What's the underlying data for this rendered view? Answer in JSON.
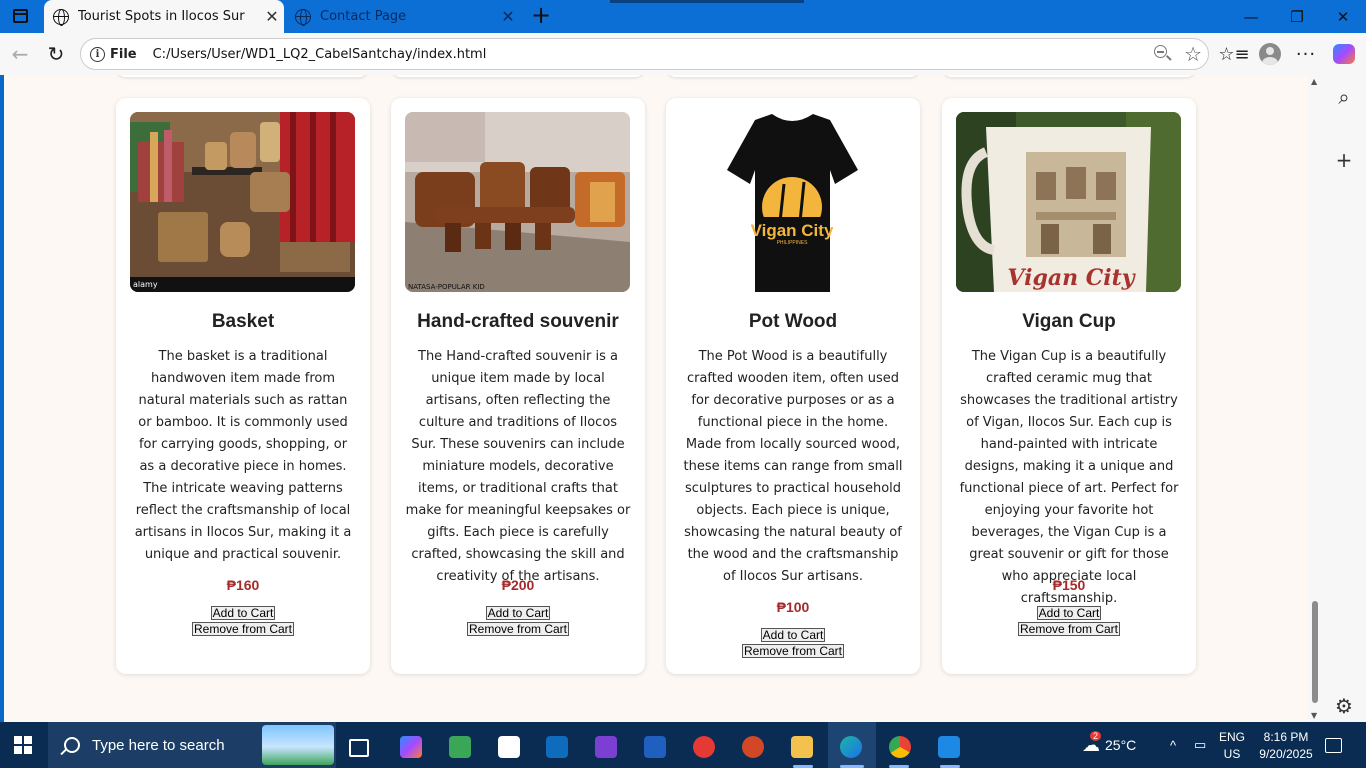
{
  "browser": {
    "tabs": [
      {
        "title": "Tourist Spots in Ilocos Sur",
        "active": true
      },
      {
        "title": "Contact Page",
        "active": false
      }
    ],
    "newtab_symbol": "+",
    "window_controls": {
      "minimize": "—",
      "restore": "❐",
      "close": "✕"
    },
    "address": {
      "protocol_label": "File",
      "url": "C:/Users/User/WD1_LQ2_CabelSantchay/index.html"
    },
    "nav": {
      "back": "←",
      "refresh": "↻"
    },
    "icons": {
      "star": "☆",
      "favorites": "☆≡",
      "more": "···"
    }
  },
  "page": {
    "products": [
      {
        "name": "Basket",
        "description": "The basket is a traditional handwoven item made from natural materials such as rattan or bamboo. It is commonly used for carrying goods, shopping, or as a decorative piece in homes. The intricate weaving patterns reflect the craftsmanship of local artisans in Ilocos Sur, making it a unique and practical souvenir.",
        "price": "₱160",
        "add_label": "Add to Cart",
        "remove_label": "Remove from Cart",
        "watermark": "alamy"
      },
      {
        "name": "Hand-crafted souvenir",
        "description": "The Hand-crafted souvenir is a unique item made by local artisans, often reflecting the culture and traditions of Ilocos Sur. These souvenirs can include miniature models, decorative items, or traditional crafts that make for meaningful keepsakes or gifts. Each piece is carefully crafted, showcasing the skill and creativity of the artisans.",
        "price": "₱200",
        "add_label": "Add to Cart",
        "remove_label": "Remove from Cart",
        "watermark": "NATASA-POPULAR KID"
      },
      {
        "name": "Pot Wood",
        "description": "The Pot Wood is a beautifully crafted wooden item, often used for decorative purposes or as a functional piece in the home. Made from locally sourced wood, these items can range from small sculptures to practical household objects. Each piece is unique, showcasing the natural beauty of the wood and the craftsmanship of Ilocos Sur artisans.",
        "price": "₱100",
        "add_label": "Add to Cart",
        "remove_label": "Remove from Cart",
        "shirt_text": "Vigan City",
        "shirt_subtext": "PHILIPPINES"
      },
      {
        "name": "Vigan Cup",
        "description": "The Vigan Cup is a beautifully crafted ceramic mug that showcases the traditional artistry of Vigan, Ilocos Sur. Each cup is hand-painted with intricate designs, making it a unique and functional piece of art. Perfect for enjoying your favorite hot beverages, the Vigan Cup is a great souvenir or gift for those who appreciate local craftsmanship.",
        "price": "₱150",
        "add_label": "Add to Cart",
        "remove_label": "Remove from Cart",
        "mug_text": "Vigan City"
      }
    ],
    "price_color": "#a52a2a",
    "background_color": "#fdf8f3"
  },
  "taskbar": {
    "search_placeholder": "Type here to search",
    "weather": "25°C",
    "weather_badge": "2",
    "language": "ENG",
    "region": "US",
    "time": "8:16 PM",
    "date": "9/20/2025",
    "tray_chevron": "^"
  }
}
